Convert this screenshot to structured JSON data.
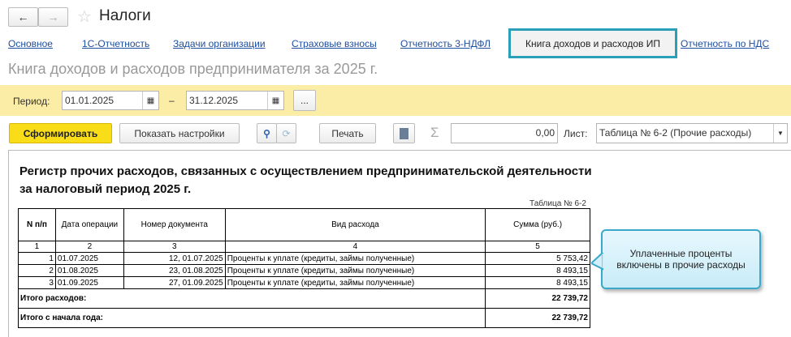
{
  "window": {
    "title": "Налоги",
    "back_icon": "arrow-left-icon",
    "forward_icon": "arrow-right-icon",
    "favorite_icon": "star-icon"
  },
  "tabs": [
    {
      "label": "Основное",
      "active": false
    },
    {
      "label": "1С-Отчетность",
      "active": false
    },
    {
      "label": "Задачи организации",
      "active": false
    },
    {
      "label": "Страховые взносы",
      "active": false
    },
    {
      "label": "Отчетность 3-НДФЛ",
      "active": false
    },
    {
      "label": "Книга доходов и расходов ИП",
      "active": true
    },
    {
      "label": "Отчетность по НДС",
      "active": false
    }
  ],
  "page": {
    "heading": "Книга доходов и расходов предпринимателя за 2025 г."
  },
  "period": {
    "label": "Период:",
    "from": "01.01.2025",
    "to": "31.12.2025",
    "dash": "–",
    "more": "..."
  },
  "toolbar": {
    "generate": "Сформировать",
    "settings": "Показать настройки",
    "print": "Печать",
    "sigma": "Σ",
    "sum_value": "0,00",
    "sheet_label": "Лист:",
    "sheet_value": "Таблица № 6-2 (Прочие расходы)"
  },
  "report": {
    "title_line1": "Регистр прочих расходов, связанных с осуществлением предпринимательской деятельности",
    "title_line2": "за налоговый период 2025 г.",
    "table_caption": "Таблица № 6-2",
    "headers": [
      "N п/п",
      "Дата операции",
      "Номер документа",
      "Вид расхода",
      "Сумма (руб.)"
    ],
    "col_numbers": [
      "1",
      "2",
      "3",
      "4",
      "5"
    ],
    "rows": [
      {
        "n": "1",
        "date": "01.07.2025",
        "doc": "12, 01.07.2025",
        "type": "Проценты к уплате (кредиты, займы полученные)",
        "sum": "5 753,42"
      },
      {
        "n": "2",
        "date": "01.08.2025",
        "doc": "23, 01.08.2025",
        "type": "Проценты к уплате (кредиты, займы полученные)",
        "sum": "8 493,15"
      },
      {
        "n": "3",
        "date": "01.09.2025",
        "doc": "27, 01.09.2025",
        "type": "Проценты к уплате (кредиты, займы полученные)",
        "sum": "8 493,15"
      }
    ],
    "total_label": "Итого расходов:",
    "total": "22 739,72",
    "ytd_label": "Итого с начала года:",
    "ytd": "22 739,72"
  },
  "callout": {
    "text": "Уплаченные проценты включены в прочие расходы"
  },
  "colors": {
    "accent_yellow": "#f8dd18",
    "period_band": "#fbeca6",
    "active_tab_border": "#2aa0b8",
    "link": "#1e4fa0",
    "callout_bg": "#d6f1fb"
  }
}
